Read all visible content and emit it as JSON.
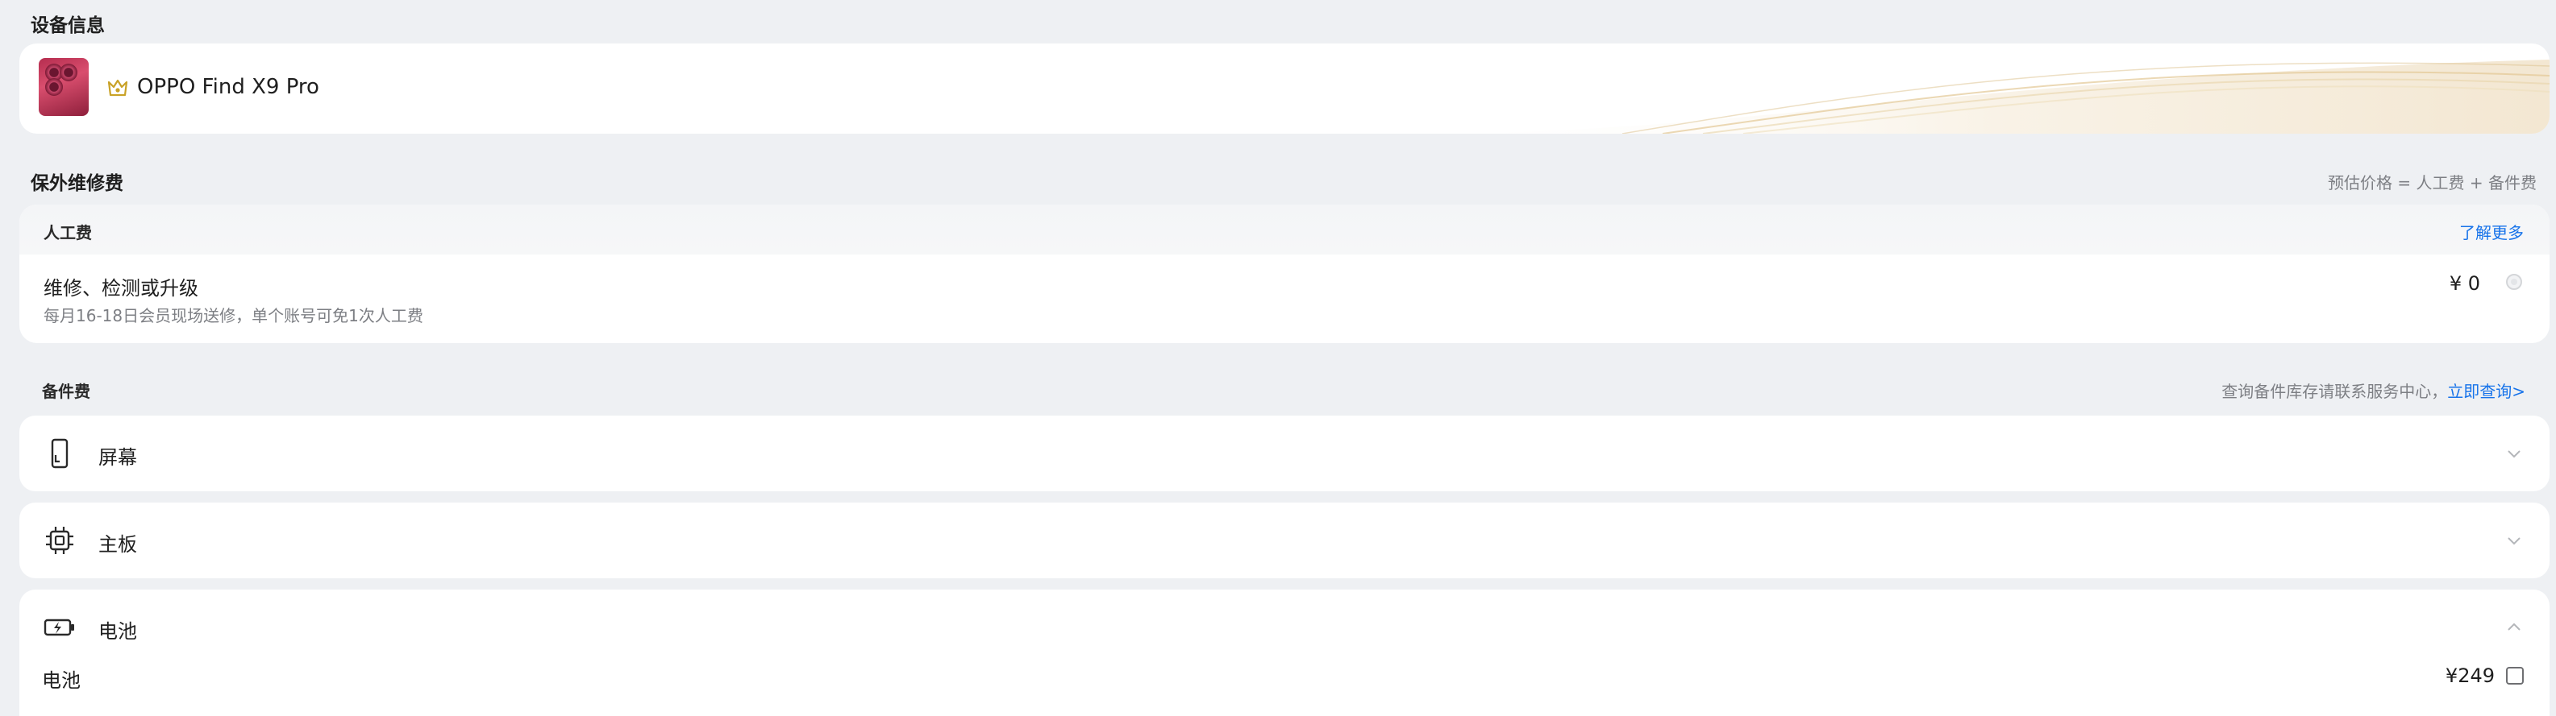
{
  "device_section": {
    "title": "设备信息",
    "device_name": "OPPO Find X9 Pro"
  },
  "repair_section": {
    "title": "保外维修费",
    "formula": "预估价格 = 人工费 + 备件费",
    "labor": {
      "title": "人工费",
      "more_link": "了解更多",
      "item_title": "维修、检测或升级",
      "item_sub": "每月16-18日会员现场送修，单个账号可免1次人工费",
      "item_price": "¥ 0"
    }
  },
  "parts_section": {
    "title": "备件费",
    "hint": "查询备件库存请联系服务中心，",
    "hint_link": "立即查询>",
    "items": [
      {
        "label": "屏幕",
        "icon": "phone-screen-icon",
        "expanded": false
      },
      {
        "label": "主板",
        "icon": "chip-icon",
        "expanded": false
      },
      {
        "label": "电池",
        "icon": "battery-icon",
        "expanded": true,
        "sub_items": [
          {
            "label": "电池",
            "price": "¥249",
            "checked": false
          }
        ]
      }
    ]
  },
  "colors": {
    "background": "#eef0f3",
    "card": "#ffffff",
    "link": "#1773ea",
    "muted_text": "#7d7f84",
    "device_accent": "#c9476a",
    "crown_gold": "#c9a227"
  }
}
